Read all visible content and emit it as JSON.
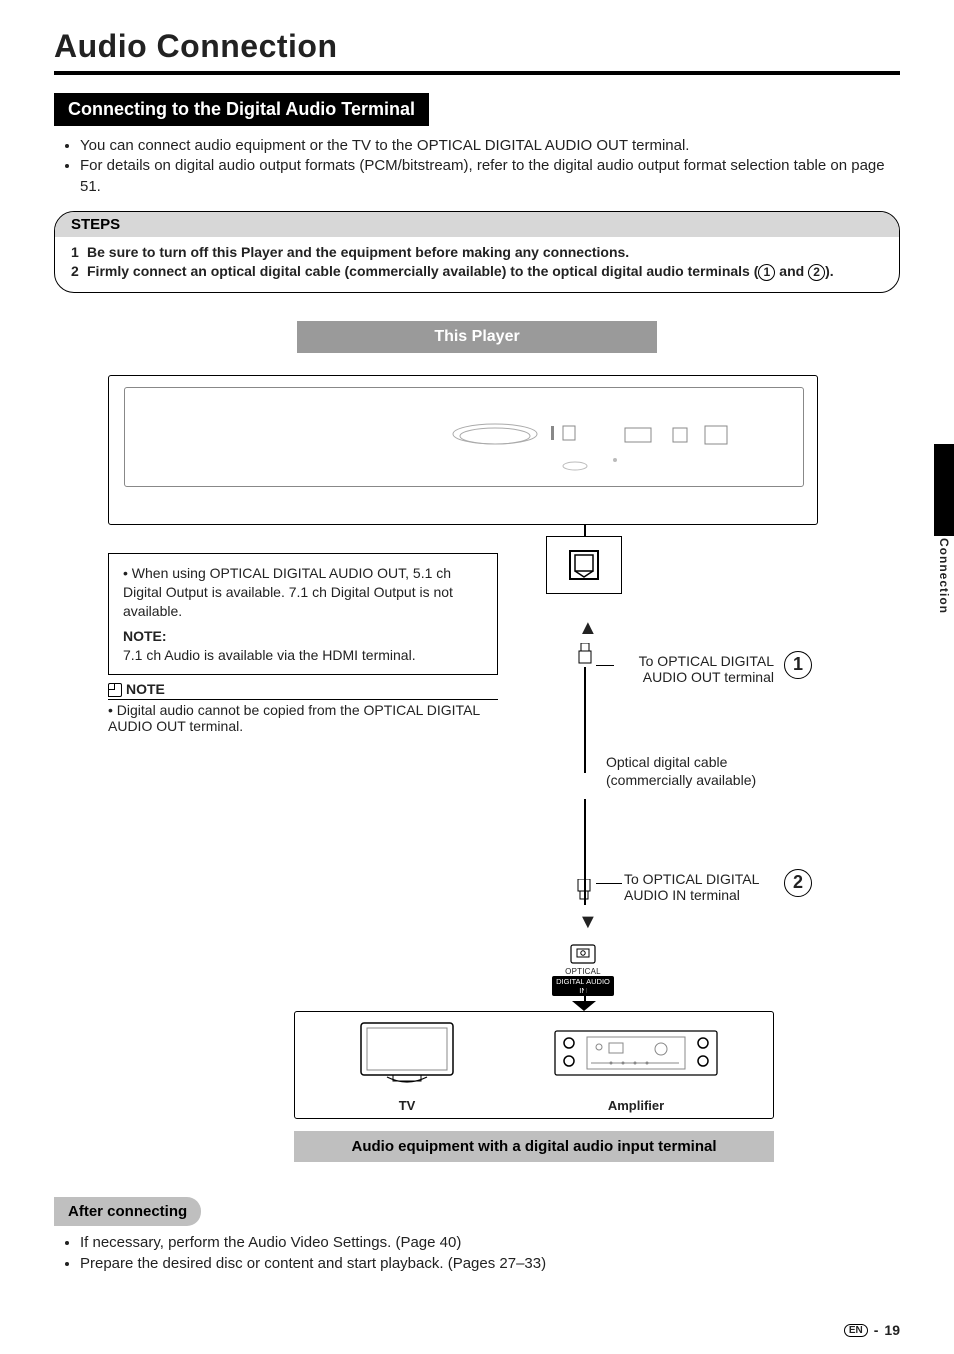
{
  "title": "Audio Connection",
  "section_head": "Connecting to the Digital Audio Terminal",
  "intro_bullets": [
    "You can connect audio equipment or the TV to the OPTICAL DIGITAL AUDIO OUT terminal.",
    "For details on digital audio output formats (PCM/bitstream), refer to the digital audio output format selection table on page 51."
  ],
  "steps": {
    "heading": "STEPS",
    "items": [
      {
        "num": "1",
        "text": "Be sure to turn off this Player and the equipment before making any connections."
      },
      {
        "num": "2",
        "text_prefix": "Firmly connect an optical digital cable (commercially available) to the optical digital audio terminals (",
        "ref1": "1",
        "mid": " and ",
        "ref2": "2",
        "suffix": ")."
      }
    ]
  },
  "diagram": {
    "this_player": "This Player",
    "info_box": {
      "bullet": "When using OPTICAL DIGITAL AUDIO OUT, 5.1 ch Digital Output is available. 7.1 ch Digital Output is not available.",
      "note_head": "NOTE:",
      "note_body": "7.1 ch Audio is available via the HDMI terminal."
    },
    "note2": {
      "title": "NOTE",
      "bullet": "Digital audio cannot be copied from the OPTICAL DIGITAL AUDIO OUT terminal."
    },
    "label_out_1": "To OPTICAL DIGITAL",
    "label_out_2": "AUDIO OUT terminal",
    "circ1": "1",
    "cable_label_1": "Optical digital cable",
    "cable_label_2": "(commercially available)",
    "label_in_1": "To OPTICAL DIGITAL",
    "label_in_2": "AUDIO IN terminal",
    "circ2": "2",
    "port_in_label": "OPTICAL",
    "port_in_bar": "DIGITAL AUDIO IN",
    "tv": "TV",
    "amplifier": "Amplifier",
    "bottom_bar": "Audio equipment with a digital audio input terminal"
  },
  "side_section": "Connection",
  "after": {
    "heading": "After connecting",
    "bullets": [
      "If necessary, perform the Audio Video Settings. (Page 40)",
      "Prepare the desired disc or content and start playback. (Pages 27–33)"
    ]
  },
  "footer": {
    "lang": "EN",
    "sep": "-",
    "page": "19"
  }
}
